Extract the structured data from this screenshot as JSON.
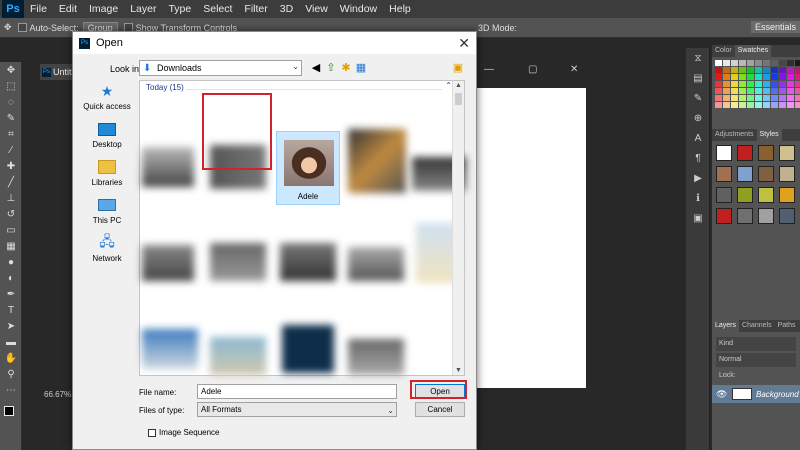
{
  "ps": {
    "logo": "Ps",
    "menus": [
      "File",
      "Edit",
      "Image",
      "Layer",
      "Type",
      "Select",
      "Filter",
      "3D",
      "View",
      "Window",
      "Help"
    ],
    "options": {
      "auto_select_label": "Auto-Select:",
      "group_value": "Group",
      "transform_label": "Show Transform Controls",
      "mode_3d": "3D Mode:",
      "workspace": "Essentials"
    },
    "doc_tab": "Untitl",
    "zoom": "66.67%",
    "panels": {
      "color_tab": "Color",
      "swatches_tab": "Swatches",
      "adjustments_tab": "Adjustments",
      "styles_tab": "Styles",
      "layers_tab": "Layers",
      "channels_tab": "Channels",
      "paths_tab": "Paths",
      "kind_label": "Kind",
      "blend_mode": "Normal",
      "lock_label": "Lock:",
      "layer_name": "Background"
    }
  },
  "dialog": {
    "title": "Open",
    "look_in_label": "Look in:",
    "look_in_value": "Downloads",
    "places": [
      {
        "label": "Quick access",
        "icon": "star-icon"
      },
      {
        "label": "Desktop",
        "icon": "desktop-icon"
      },
      {
        "label": "Libraries",
        "icon": "libraries-icon"
      },
      {
        "label": "This PC",
        "icon": "computer-icon"
      },
      {
        "label": "Network",
        "icon": "network-icon"
      }
    ],
    "group_header": "Today (15)",
    "selected_file": "Adele",
    "file_name_label": "File name:",
    "file_name_value": "Adele",
    "files_of_type_label": "Files of type:",
    "files_of_type_value": "All Formats",
    "open_button": "Open",
    "cancel_button": "Cancel",
    "image_sequence_label": "Image Sequence"
  },
  "colors": {
    "highlight_red": "#d2232a",
    "selection_blue": "#cce8ff",
    "ps_dark": "#282828"
  }
}
